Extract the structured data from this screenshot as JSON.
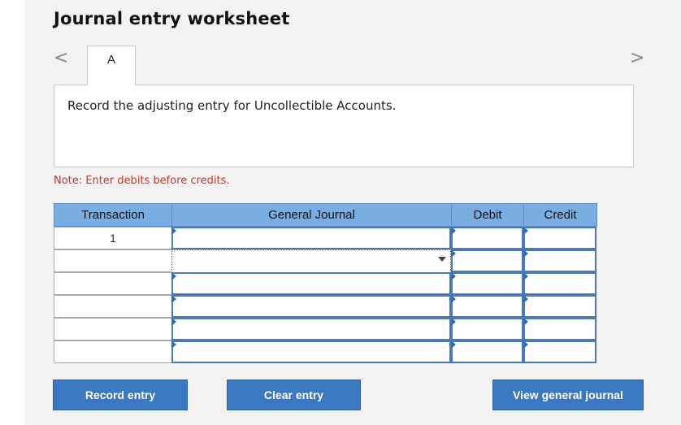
{
  "worksheet": {
    "title": "Journal entry worksheet",
    "prev_label": "<",
    "next_label": ">",
    "tabs": [
      {
        "label": "A"
      }
    ],
    "instruction": "Record the adjusting entry for Uncollectible Accounts.",
    "note": "Note: Enter debits before credits."
  },
  "table": {
    "headers": {
      "transaction": "Transaction",
      "general_journal": "General Journal",
      "debit": "Debit",
      "credit": "Credit"
    },
    "rows": [
      {
        "transaction": "1",
        "account": "",
        "debit": "",
        "credit": ""
      },
      {
        "transaction": "",
        "account": "",
        "debit": "",
        "credit": ""
      },
      {
        "transaction": "",
        "account": "",
        "debit": "",
        "credit": ""
      },
      {
        "transaction": "",
        "account": "",
        "debit": "",
        "credit": ""
      },
      {
        "transaction": "",
        "account": "",
        "debit": "",
        "credit": ""
      },
      {
        "transaction": "",
        "account": "",
        "debit": "",
        "credit": ""
      }
    ]
  },
  "buttons": {
    "record": "Record entry",
    "clear": "Clear entry",
    "view": "View general journal"
  },
  "colors": {
    "header_bg": "#7aaee2",
    "button_bg": "#3a78c2",
    "note": "#c0392b",
    "input_border": "#4a79b4"
  }
}
